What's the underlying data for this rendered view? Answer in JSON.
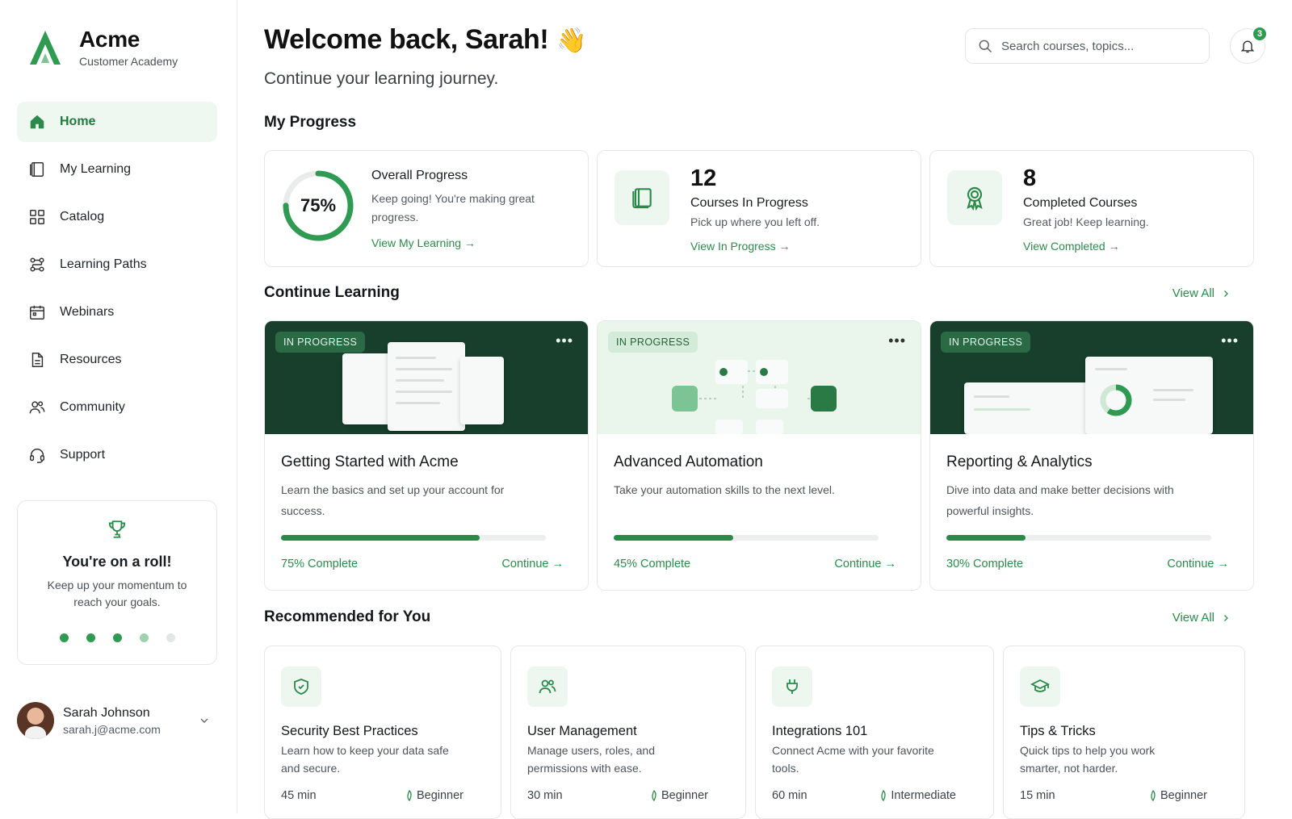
{
  "brand": {
    "name": "Acme",
    "subtitle": "Customer Academy"
  },
  "sidebar": {
    "items": [
      {
        "label": "Home",
        "icon": "home-icon",
        "active": true
      },
      {
        "label": "My Learning",
        "icon": "book-icon"
      },
      {
        "label": "Catalog",
        "icon": "grid-icon"
      },
      {
        "label": "Learning Paths",
        "icon": "path-icon"
      },
      {
        "label": "Webinars",
        "icon": "calendar-icon"
      },
      {
        "label": "Resources",
        "icon": "document-icon"
      },
      {
        "label": "Community",
        "icon": "users-icon"
      },
      {
        "label": "Support",
        "icon": "headset-icon"
      }
    ],
    "roll_card": {
      "title": "You're on a roll!",
      "text": "Keep up your momentum to reach your goals."
    },
    "user": {
      "name": "Sarah Johnson",
      "email": "sarah.j@acme.com"
    }
  },
  "header": {
    "welcome": "Welcome back, Sarah!",
    "wave": "👋",
    "subtitle": "Continue your learning journey.",
    "search_placeholder": "Search courses, topics...",
    "notification_count": "3"
  },
  "progress": {
    "title": "My Progress",
    "overall": {
      "percent_label": "75%",
      "percent": 75,
      "title": "Overall Progress",
      "text": "Keep going! You're making great progress.",
      "link": "View My Learning →"
    },
    "in_progress": {
      "count": "12",
      "title": "Courses In Progress",
      "text": "Pick up where you left off.",
      "link": "View In Progress →"
    },
    "completed": {
      "count": "8",
      "title": "Completed Courses",
      "text": "Great job! Keep learning.",
      "link": "View Completed →"
    }
  },
  "continue": {
    "title": "Continue Learning",
    "view_all": "View All",
    "courses": [
      {
        "badge": "IN PROGRESS",
        "title": "Getting Started with Acme",
        "desc": "Learn the basics and set up your account for success.",
        "percent": 75,
        "percent_label": "75% Complete",
        "action": "Continue →"
      },
      {
        "badge": "IN PROGRESS",
        "title": "Advanced Automation",
        "desc": "Take your automation skills to the next level.",
        "percent": 45,
        "percent_label": "45% Complete",
        "action": "Continue →"
      },
      {
        "badge": "IN PROGRESS",
        "title": "Reporting & Analytics",
        "desc": "Dive into data and make better decisions with powerful insights.",
        "percent": 30,
        "percent_label": "30% Complete",
        "action": "Continue →"
      }
    ]
  },
  "recommended": {
    "title": "Recommended for You",
    "view_all": "View All",
    "items": [
      {
        "icon": "shield-icon",
        "title": "Security Best Practices",
        "desc": "Learn how to keep your data safe and secure.",
        "time": "45 min",
        "level": "Beginner"
      },
      {
        "icon": "users-icon",
        "title": "User Management",
        "desc": "Manage users, roles, and permissions with ease.",
        "time": "30 min",
        "level": "Beginner"
      },
      {
        "icon": "plug-icon",
        "title": "Integrations 101",
        "desc": "Connect Acme with your favorite tools.",
        "time": "60 min",
        "level": "Intermediate"
      },
      {
        "icon": "graduation-cap-icon",
        "title": "Tips & Tricks",
        "desc": "Quick tips to help you work smarter, not harder.",
        "time": "15 min",
        "level": "Beginner"
      }
    ]
  },
  "colors": {
    "accent": "#2b8a4a",
    "accent_light": "#eef6f0",
    "dark_cover": "#173f2b"
  }
}
